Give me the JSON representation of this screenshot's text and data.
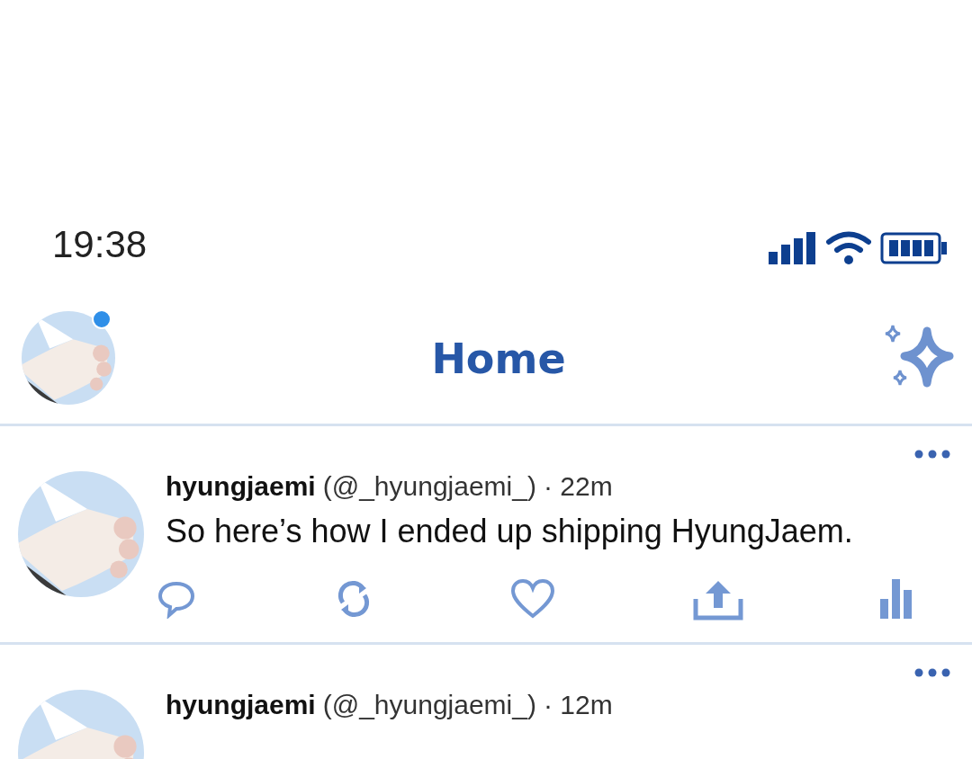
{
  "status_bar": {
    "time": "19:38"
  },
  "header": {
    "title": "Home",
    "has_notification": true
  },
  "posts": [
    {
      "name": "hyungjaemi",
      "handle": "(@_hyungjaemi_)",
      "time": "· 22m",
      "text": "So here’s how I ended up shipping HyungJaem."
    },
    {
      "name": "hyungjaemi",
      "handle": "(@_hyungjaemi_)",
      "time": "· 12m"
    }
  ]
}
